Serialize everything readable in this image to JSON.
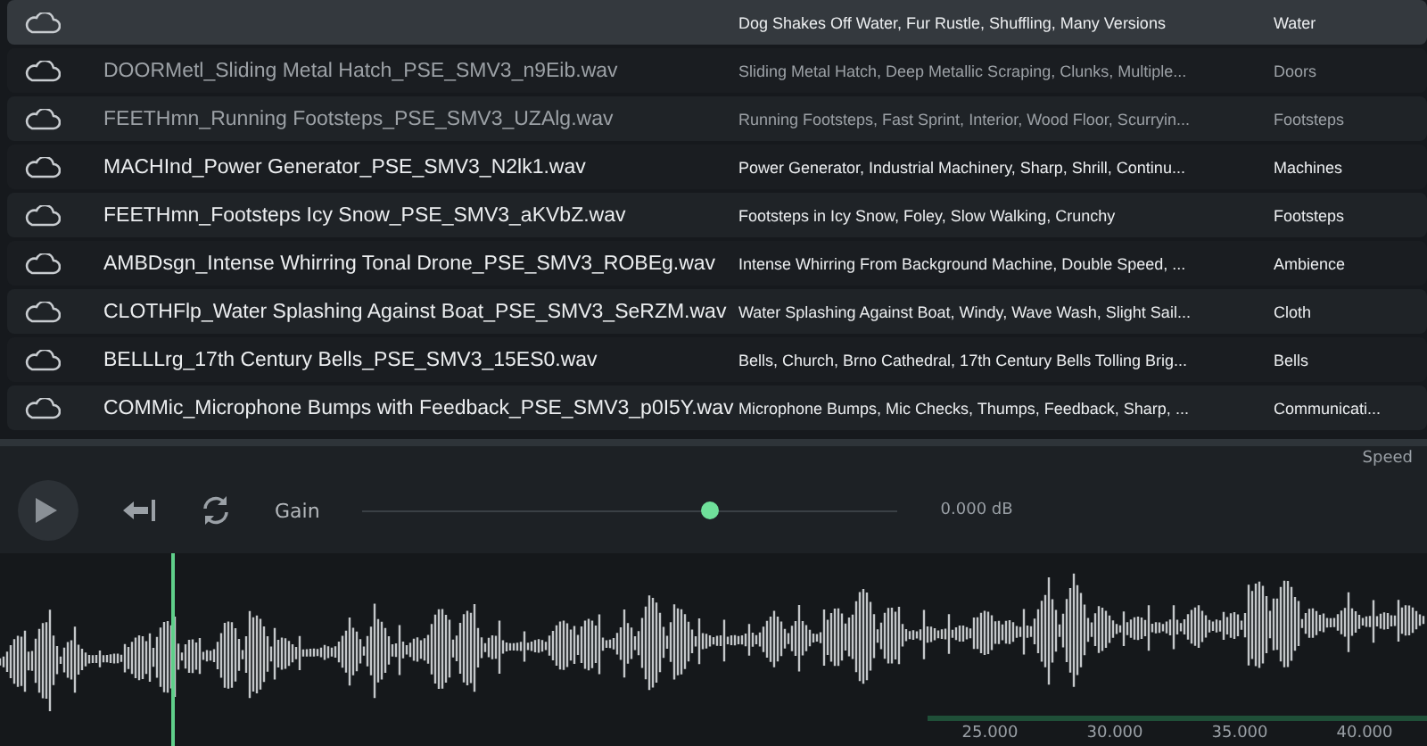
{
  "files": [
    {
      "description": "Dog Shakes Off Water, Fur Rustle, Shuffling, Many Versions",
      "category": "Water",
      "dimmed": false,
      "selected": true
    },
    {
      "filename": "DOORMetl_Sliding Metal Hatch_PSE_SMV3_n9Eib.wav",
      "description": "Sliding Metal Hatch, Deep Metallic Scraping, Clunks, Multiple...",
      "category": "Doors",
      "dimmed": true,
      "selected": false
    },
    {
      "filename": "FEETHmn_Running Footsteps_PSE_SMV3_UZAlg.wav",
      "description": "Running Footsteps, Fast Sprint, Interior, Wood Floor, Scurryin...",
      "category": "Footsteps",
      "dimmed": true,
      "selected": false
    },
    {
      "filename": "MACHInd_Power Generator_PSE_SMV3_N2lk1.wav",
      "description": "Power Generator, Industrial Machinery, Sharp, Shrill, Continu...",
      "category": "Machines",
      "dimmed": false,
      "selected": false
    },
    {
      "filename": "FEETHmn_Footsteps Icy Snow_PSE_SMV3_aKVbZ.wav",
      "description": "Footsteps in Icy Snow, Foley, Slow Walking, Crunchy",
      "category": "Footsteps",
      "dimmed": false,
      "selected": false
    },
    {
      "filename": "AMBDsgn_Intense Whirring Tonal Drone_PSE_SMV3_ROBEg.wav",
      "description": "Intense Whirring From Background Machine, Double Speed, ...",
      "category": "Ambience",
      "dimmed": false,
      "selected": false
    },
    {
      "filename": "CLOTHFlp_Water Splashing Against Boat_PSE_SMV3_SeRZM.wav",
      "description": "Water Splashing Against Boat, Windy, Wave Wash, Slight Sail...",
      "category": "Cloth",
      "dimmed": false,
      "selected": false
    },
    {
      "filename": "BELLLrg_17th Century Bells_PSE_SMV3_15ES0.wav",
      "description": "Bells, Church, Brno Cathedral, 17th Century Bells Tolling Brig...",
      "category": "Bells",
      "dimmed": false,
      "selected": false
    },
    {
      "filename": "COMMic_Microphone Bumps with Feedback_PSE_SMV3_p0I5Y.wav",
      "description": "Microphone Bumps, Mic Checks, Thumps, Feedback, Sharp, ...",
      "category": "Communicati...",
      "dimmed": false,
      "selected": false
    }
  ],
  "player": {
    "speed_label": "Speed",
    "gain_label": "Gain",
    "gain": {
      "level": 0.65
    },
    "gain_reading": "0.000 dB",
    "playhead": {
      "level": 0.12
    },
    "ruler": [
      "25.000",
      "30.000",
      "35.000",
      "40.000"
    ]
  }
}
